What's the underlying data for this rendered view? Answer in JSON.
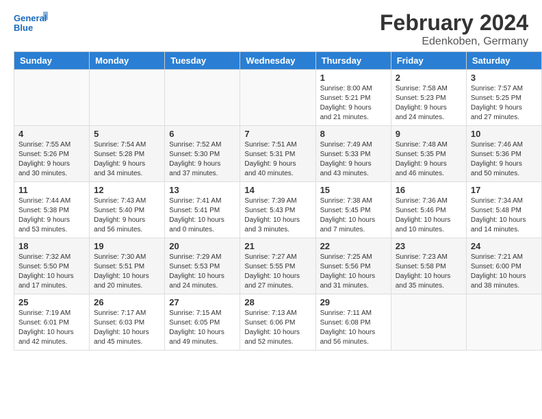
{
  "header": {
    "logo_line1": "General",
    "logo_line2": "Blue",
    "main_title": "February 2024",
    "subtitle": "Edenkoben, Germany"
  },
  "days_of_week": [
    "Sunday",
    "Monday",
    "Tuesday",
    "Wednesday",
    "Thursday",
    "Friday",
    "Saturday"
  ],
  "weeks": [
    [
      {
        "day": "",
        "info": ""
      },
      {
        "day": "",
        "info": ""
      },
      {
        "day": "",
        "info": ""
      },
      {
        "day": "",
        "info": ""
      },
      {
        "day": "1",
        "info": "Sunrise: 8:00 AM\nSunset: 5:21 PM\nDaylight: 9 hours\nand 21 minutes."
      },
      {
        "day": "2",
        "info": "Sunrise: 7:58 AM\nSunset: 5:23 PM\nDaylight: 9 hours\nand 24 minutes."
      },
      {
        "day": "3",
        "info": "Sunrise: 7:57 AM\nSunset: 5:25 PM\nDaylight: 9 hours\nand 27 minutes."
      }
    ],
    [
      {
        "day": "4",
        "info": "Sunrise: 7:55 AM\nSunset: 5:26 PM\nDaylight: 9 hours\nand 30 minutes."
      },
      {
        "day": "5",
        "info": "Sunrise: 7:54 AM\nSunset: 5:28 PM\nDaylight: 9 hours\nand 34 minutes."
      },
      {
        "day": "6",
        "info": "Sunrise: 7:52 AM\nSunset: 5:30 PM\nDaylight: 9 hours\nand 37 minutes."
      },
      {
        "day": "7",
        "info": "Sunrise: 7:51 AM\nSunset: 5:31 PM\nDaylight: 9 hours\nand 40 minutes."
      },
      {
        "day": "8",
        "info": "Sunrise: 7:49 AM\nSunset: 5:33 PM\nDaylight: 9 hours\nand 43 minutes."
      },
      {
        "day": "9",
        "info": "Sunrise: 7:48 AM\nSunset: 5:35 PM\nDaylight: 9 hours\nand 46 minutes."
      },
      {
        "day": "10",
        "info": "Sunrise: 7:46 AM\nSunset: 5:36 PM\nDaylight: 9 hours\nand 50 minutes."
      }
    ],
    [
      {
        "day": "11",
        "info": "Sunrise: 7:44 AM\nSunset: 5:38 PM\nDaylight: 9 hours\nand 53 minutes."
      },
      {
        "day": "12",
        "info": "Sunrise: 7:43 AM\nSunset: 5:40 PM\nDaylight: 9 hours\nand 56 minutes."
      },
      {
        "day": "13",
        "info": "Sunrise: 7:41 AM\nSunset: 5:41 PM\nDaylight: 10 hours\nand 0 minutes."
      },
      {
        "day": "14",
        "info": "Sunrise: 7:39 AM\nSunset: 5:43 PM\nDaylight: 10 hours\nand 3 minutes."
      },
      {
        "day": "15",
        "info": "Sunrise: 7:38 AM\nSunset: 5:45 PM\nDaylight: 10 hours\nand 7 minutes."
      },
      {
        "day": "16",
        "info": "Sunrise: 7:36 AM\nSunset: 5:46 PM\nDaylight: 10 hours\nand 10 minutes."
      },
      {
        "day": "17",
        "info": "Sunrise: 7:34 AM\nSunset: 5:48 PM\nDaylight: 10 hours\nand 14 minutes."
      }
    ],
    [
      {
        "day": "18",
        "info": "Sunrise: 7:32 AM\nSunset: 5:50 PM\nDaylight: 10 hours\nand 17 minutes."
      },
      {
        "day": "19",
        "info": "Sunrise: 7:30 AM\nSunset: 5:51 PM\nDaylight: 10 hours\nand 20 minutes."
      },
      {
        "day": "20",
        "info": "Sunrise: 7:29 AM\nSunset: 5:53 PM\nDaylight: 10 hours\nand 24 minutes."
      },
      {
        "day": "21",
        "info": "Sunrise: 7:27 AM\nSunset: 5:55 PM\nDaylight: 10 hours\nand 27 minutes."
      },
      {
        "day": "22",
        "info": "Sunrise: 7:25 AM\nSunset: 5:56 PM\nDaylight: 10 hours\nand 31 minutes."
      },
      {
        "day": "23",
        "info": "Sunrise: 7:23 AM\nSunset: 5:58 PM\nDaylight: 10 hours\nand 35 minutes."
      },
      {
        "day": "24",
        "info": "Sunrise: 7:21 AM\nSunset: 6:00 PM\nDaylight: 10 hours\nand 38 minutes."
      }
    ],
    [
      {
        "day": "25",
        "info": "Sunrise: 7:19 AM\nSunset: 6:01 PM\nDaylight: 10 hours\nand 42 minutes."
      },
      {
        "day": "26",
        "info": "Sunrise: 7:17 AM\nSunset: 6:03 PM\nDaylight: 10 hours\nand 45 minutes."
      },
      {
        "day": "27",
        "info": "Sunrise: 7:15 AM\nSunset: 6:05 PM\nDaylight: 10 hours\nand 49 minutes."
      },
      {
        "day": "28",
        "info": "Sunrise: 7:13 AM\nSunset: 6:06 PM\nDaylight: 10 hours\nand 52 minutes."
      },
      {
        "day": "29",
        "info": "Sunrise: 7:11 AM\nSunset: 6:08 PM\nDaylight: 10 hours\nand 56 minutes."
      },
      {
        "day": "",
        "info": ""
      },
      {
        "day": "",
        "info": ""
      }
    ]
  ]
}
